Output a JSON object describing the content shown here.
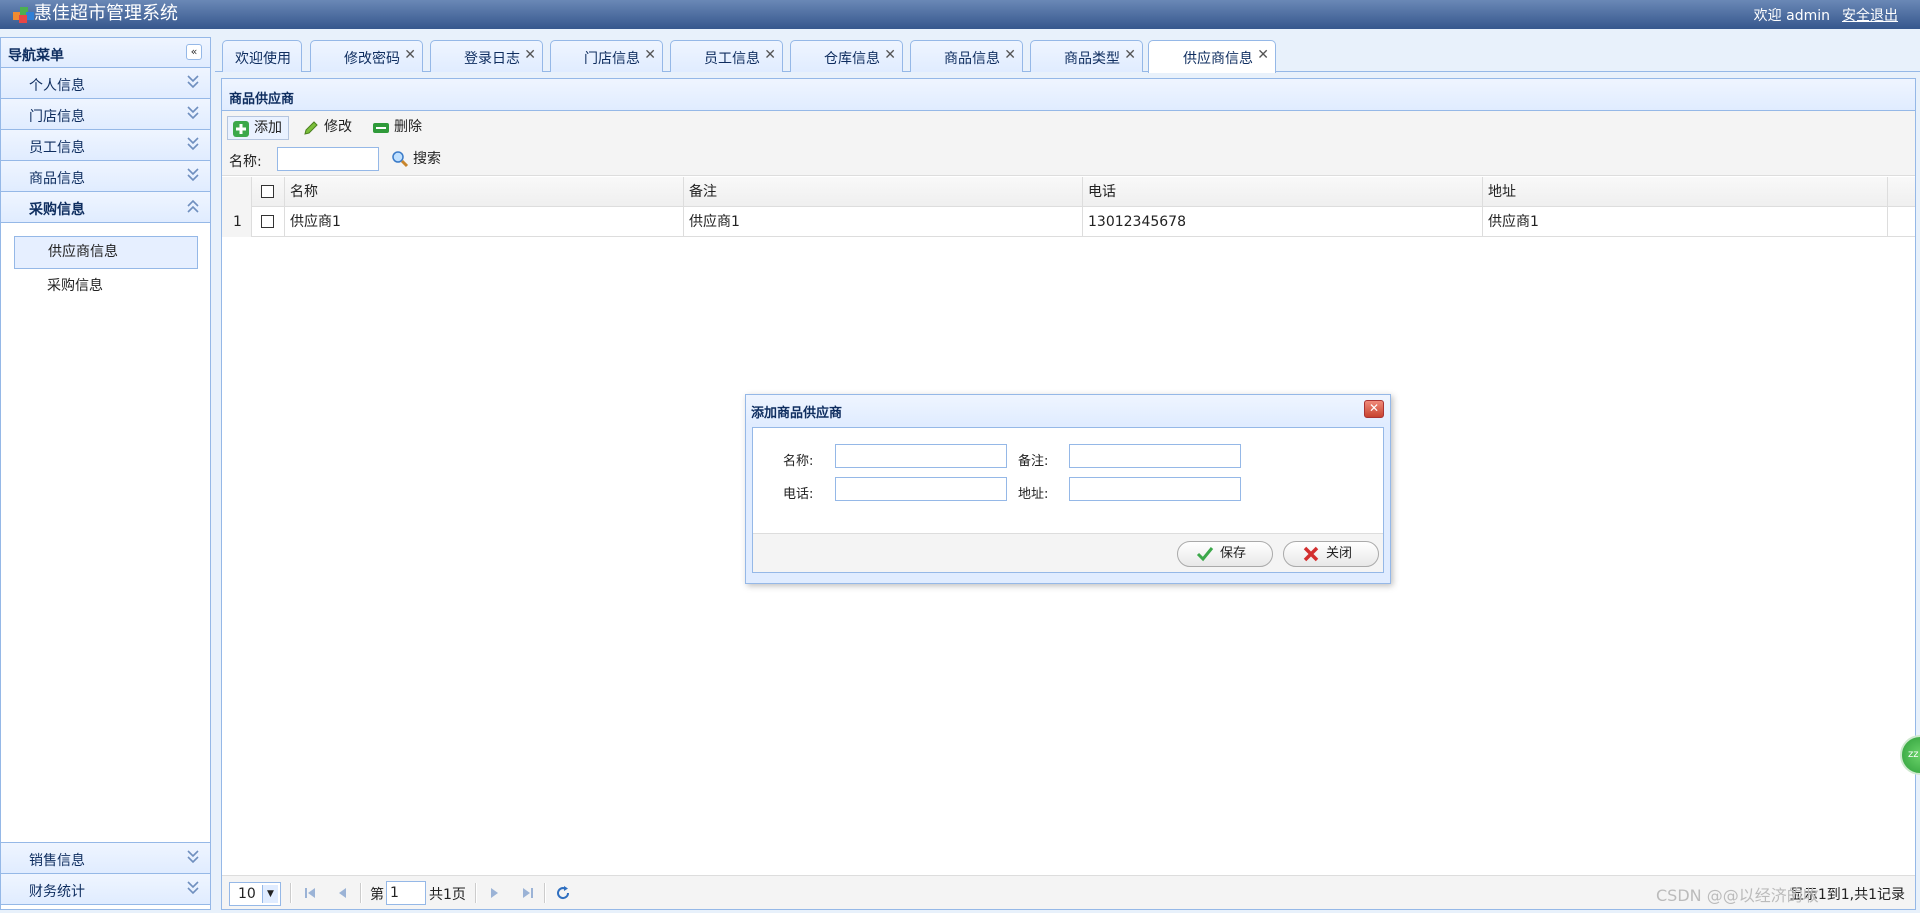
{
  "header": {
    "title": "惠佳超市管理系统",
    "welcome": "欢迎 admin",
    "logout": "安全退出"
  },
  "sidebar": {
    "title": "导航菜单",
    "items": [
      {
        "label": "个人信息"
      },
      {
        "label": "门店信息"
      },
      {
        "label": "员工信息"
      },
      {
        "label": "商品信息"
      },
      {
        "label": "采购信息"
      }
    ],
    "sub_items": [
      {
        "label": "供应商信息"
      },
      {
        "label": "采购信息"
      }
    ],
    "bottom_items": [
      {
        "label": "销售信息"
      },
      {
        "label": "财务统计"
      }
    ]
  },
  "tabs": [
    {
      "label": "欢迎使用"
    },
    {
      "label": "修改密码"
    },
    {
      "label": "登录日志"
    },
    {
      "label": "门店信息"
    },
    {
      "label": "员工信息"
    },
    {
      "label": "仓库信息"
    },
    {
      "label": "商品信息"
    },
    {
      "label": "商品类型"
    },
    {
      "label": "供应商信息"
    }
  ],
  "panel": {
    "title": "商品供应商",
    "toolbar": {
      "add": "添加",
      "edit": "修改",
      "delete": "删除",
      "search_label": "名称:",
      "search_button": "搜索"
    },
    "grid": {
      "columns": [
        "名称",
        "备注",
        "电话",
        "地址"
      ],
      "rows": [
        {
          "num": "1",
          "name": "供应商1",
          "remark": "供应商1",
          "phone": "13012345678",
          "address": "供应商1"
        }
      ]
    },
    "pager": {
      "page_size": "10",
      "page_prefix": "第",
      "page_value": "1",
      "page_total": "共1页",
      "info": "显示1到1,共1记录"
    }
  },
  "dialog": {
    "title": "添加商品供应商",
    "fields": {
      "name_label": "名称:",
      "remark_label": "备注:",
      "phone_label": "电话:",
      "address_label": "地址:"
    },
    "save": "保存",
    "close": "关闭"
  },
  "watermark": "CSDN @@以经济的收"
}
